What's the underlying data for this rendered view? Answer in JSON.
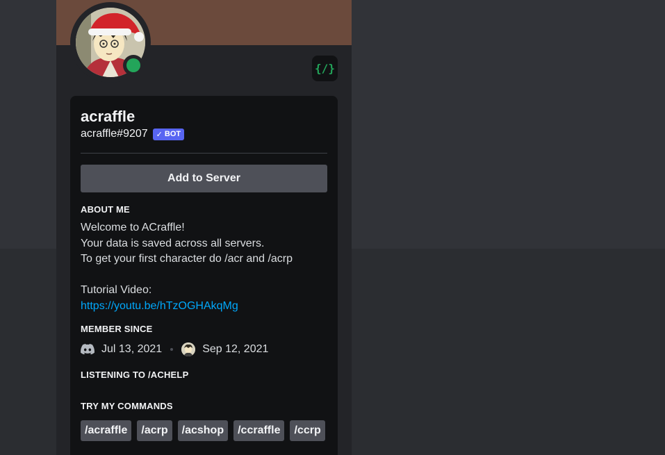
{
  "profile": {
    "display_name": "acraffle",
    "username": "acraffle#9207",
    "bot_tag": "BOT",
    "status": "online",
    "badge_icon": "slash-commands-icon",
    "banner_color": "#6b4a3c"
  },
  "actions": {
    "add_to_server": "Add to Server"
  },
  "about": {
    "title": "ABOUT ME",
    "line1": "Welcome to ACraffle!",
    "line2": "Your data is saved across all servers.",
    "line3": "To get your first character do /acr and /acrp",
    "line4": "Tutorial Video:",
    "link": "https://youtu.be/hTzOGHAkqMg"
  },
  "member_since": {
    "title": "MEMBER SINCE",
    "discord_date": "Jul 13, 2021",
    "server_date": "Sep 12, 2021"
  },
  "activity": {
    "title": "LISTENING TO /ACHELP"
  },
  "commands": {
    "title": "TRY MY COMMANDS",
    "items": [
      "/acraffle",
      "/acrp",
      "/acshop",
      "/ccraffle",
      "/ccrp"
    ]
  },
  "colors": {
    "accent": "#5865f2",
    "online": "#23a55a",
    "link": "#00a8fc"
  }
}
